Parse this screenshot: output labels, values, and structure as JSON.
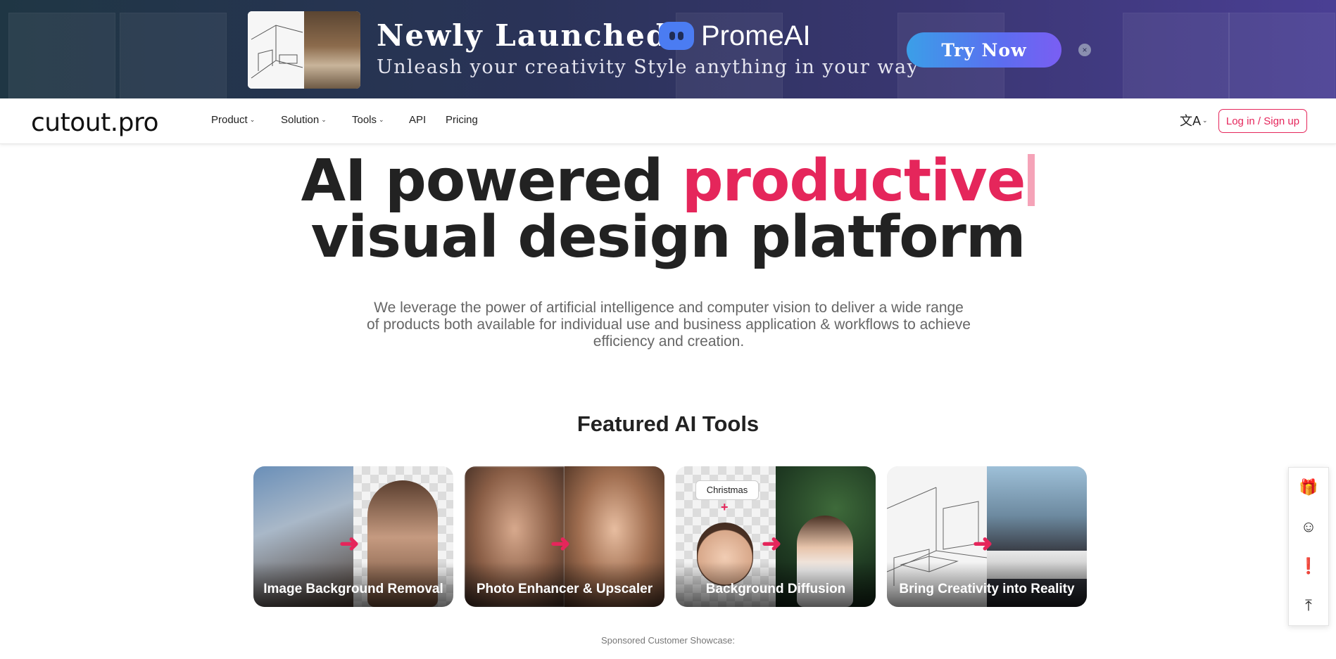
{
  "banner": {
    "headline": "Newly Launched",
    "brand": "PromeAI",
    "subtitle": "Unleash your creativity Style anything in your way",
    "cta_label": "Try Now",
    "close_icon": "×"
  },
  "nav": {
    "logo": "cutout.pro",
    "items": [
      {
        "label": "Product",
        "caret": "⌄"
      },
      {
        "label": "Solution",
        "caret": "⌄"
      },
      {
        "label": "Tools",
        "caret": "⌄"
      },
      {
        "label": "API"
      },
      {
        "label": "Pricing"
      }
    ],
    "language_icon": "文A",
    "language_caret": "⌄",
    "login_label": "Log in / Sign up"
  },
  "hero": {
    "title_part1": "AI powered ",
    "title_accent": "productive",
    "title_line2": "visual design platform",
    "description": "We leverage the power of artificial intelligence and computer vision to deliver a wide range of products both available for individual use and business application & workflows to achieve efficiency and creation."
  },
  "featured": {
    "title": "Featured AI Tools",
    "tools": [
      {
        "label": "Image Background Removal",
        "icon": "background-removal"
      },
      {
        "label": "Photo Enhancer & Upscaler",
        "icon": "photo-enhancer"
      },
      {
        "label": "Background Diffusion",
        "icon": "background-diffusion",
        "tag": "Christmas",
        "plus": "+"
      },
      {
        "label": "Bring Creativity into Reality",
        "icon": "sketch-to-reality"
      }
    ],
    "arrow_glyph": "➜"
  },
  "sponsored": "Sponsored Customer Showcase:",
  "side_toolbar": {
    "gift_icon": "🎁",
    "support_icon": "☺",
    "feedback_icon": "❗",
    "back_to_top_icon": "⤒"
  },
  "colors": {
    "accent": "#e5265b",
    "cta_gradient_start": "#3b9fe8",
    "cta_gradient_end": "#7a5ef3",
    "banner_bg": "#2a3358"
  }
}
